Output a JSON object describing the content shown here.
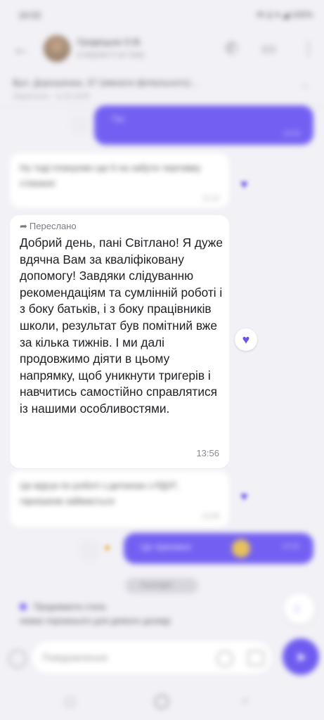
{
  "status_bar": {
    "time": "16:02",
    "right": "✉ ◎ ▾ ◢ 100%"
  },
  "header": {
    "contact_name": "Гродецька О.В.",
    "contact_status": "в мережі 5 хв тому"
  },
  "pinned": {
    "title": "Вул. Дорошенка, 37 (кімнати філіального)...",
    "subtitle": "Закріплено · 11.02.2025"
  },
  "messages": {
    "out_top": {
      "text": "Так",
      "time": "13:01"
    },
    "in_1": {
      "text": "Ну тоді плануємо ще 6 на забути черговму стиканні",
      "time": "11:22"
    },
    "forwarded": {
      "label": "Переслано",
      "text": "Добрий день, пані Світлано! Я дуже вдячна Вам за кваліфіковану допомогу! Завдяки слідуванню рекомендаціям та сумлінній роботі і з боку батьків, і з боку працівників школи, результат був помітний вже за кілька тижнів. І ми далі продовжимо діяти в цьому напрямку, щоб уникнути тригерів і навчитись самостійно справлятися із нашими особливостями.",
      "time": "13:56"
    },
    "in_2": {
      "text": "Це відгук по роботі з дитиною з РДУГ, гарнішком займається",
      "time": "13:58"
    },
    "out_bottom": {
      "text": "Це приємно",
      "time": "14:00"
    }
  },
  "date_chip": "Сьогодні",
  "reply_bar": {
    "title": "Продовжити стиль",
    "subtitle": "немає порожнього для деякого досвіді"
  },
  "input": {
    "placeholder": "Повідомлення"
  },
  "colors": {
    "accent": "#7360f2",
    "heart": "#6a55e8",
    "background": "#f2f1f6"
  }
}
